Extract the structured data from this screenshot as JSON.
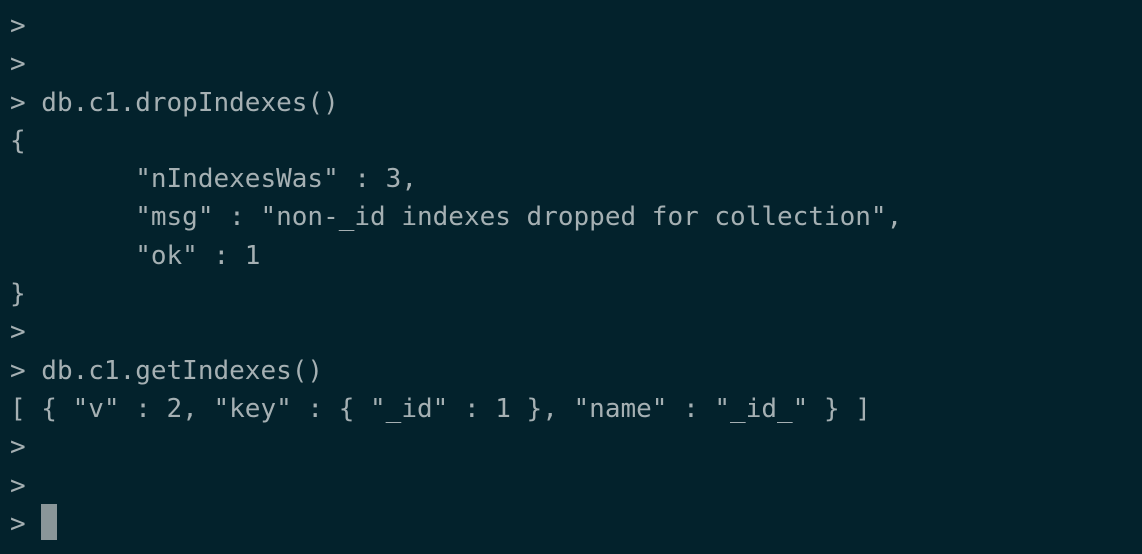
{
  "terminal": {
    "lines": [
      ">",
      ">",
      "> db.c1.dropIndexes()",
      "{",
      "        \"nIndexesWas\" : 3,",
      "        \"msg\" : \"non-_id indexes dropped for collection\",",
      "        \"ok\" : 1",
      "}",
      ">",
      "> db.c1.getIndexes()",
      "[ { \"v\" : 2, \"key\" : { \"_id\" : 1 }, \"name\" : \"_id_\" } ]",
      ">",
      ">"
    ],
    "prompt": "> "
  },
  "colors": {
    "background": "#03222c",
    "foreground": "#a5b0b3",
    "cursor": "#8a9699"
  }
}
